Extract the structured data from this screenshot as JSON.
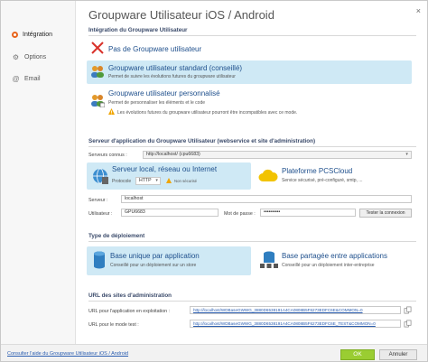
{
  "window": {
    "title": "Groupware Utilisateur iOS / Android",
    "close": "×"
  },
  "sidebar": {
    "items": [
      {
        "label": "Intégration",
        "icon": "radio-dot-icon"
      },
      {
        "label": "Options",
        "icon": "gear-icon"
      },
      {
        "label": "Email",
        "icon": "at-icon"
      }
    ]
  },
  "integration": {
    "section_title": "Intégration du Groupware Utilisateur",
    "options": [
      {
        "title": "Pas de Groupware utilisateur",
        "desc": ""
      },
      {
        "title": "Groupware utilisateur standard (conseillé)",
        "desc": "Permet de suivre les évolutions futures du groupware utilisateur"
      },
      {
        "title": "Groupware utilisateur personnalisé",
        "desc": "Permet de personnaliser les éléments et le code",
        "warning": "Les évolutions futures du groupware utilisateur pourront être incompatibles avec ce mode."
      }
    ]
  },
  "server": {
    "section_title": "Serveur d'application du Groupware Utilisateur (webservice et site d'administration)",
    "known_label": "Serveurs connus :",
    "known_value": "http://localhost/ (cpu6683)",
    "local": {
      "title": "Serveur local, réseau ou Internet",
      "protocol_label": "Protocole",
      "protocol_value": "HTTP",
      "warning": "Non sécurisé"
    },
    "cloud": {
      "title": "Plateforme PCSCloud",
      "desc": "Service sécurisé, pré-configuré, smtp, ...",
      "logo": "PCSCloud"
    },
    "server_label": "Serveur :",
    "server_value": "localhost",
    "user_label": "Utilisateur :",
    "user_value": "GPU6683",
    "password_label": "Mot de passe :",
    "password_value": "••••••••••",
    "test_button": "Tester la connexion"
  },
  "deployment": {
    "section_title": "Type de déploiement",
    "single": {
      "title": "Base unique par application",
      "desc": "Conseillé pour un déploiement sur un store"
    },
    "shared": {
      "title": "Base partagée entre applications",
      "desc": "Conseillé pour un déploiement inter-entreprise"
    }
  },
  "admin": {
    "section_title": "URL des sites d'administration",
    "prod_label": "URL pour l'application en exploitation :",
    "prod_url": "http://localhost/WDBaseGWWG_3880D6538191A4CA0808B5F6273EDFC6E&COMMON=0",
    "test_label": "URL pour le mode test :",
    "test_url": "http://localhost/WDBaseGWWG_3880D6538191A4CA0808B5F6273EDFC6E_TEST&COMMON=0"
  },
  "footer": {
    "help_link": "Consulter l'aide du Groupware Utilisateur iOS / Android",
    "ok": "OK",
    "cancel": "Annuler"
  },
  "colors": {
    "accent_orange": "#e8651d",
    "selected_bg": "#cfe9f5",
    "title_blue": "#1e4f8c",
    "ok_green": "#9acd32"
  }
}
